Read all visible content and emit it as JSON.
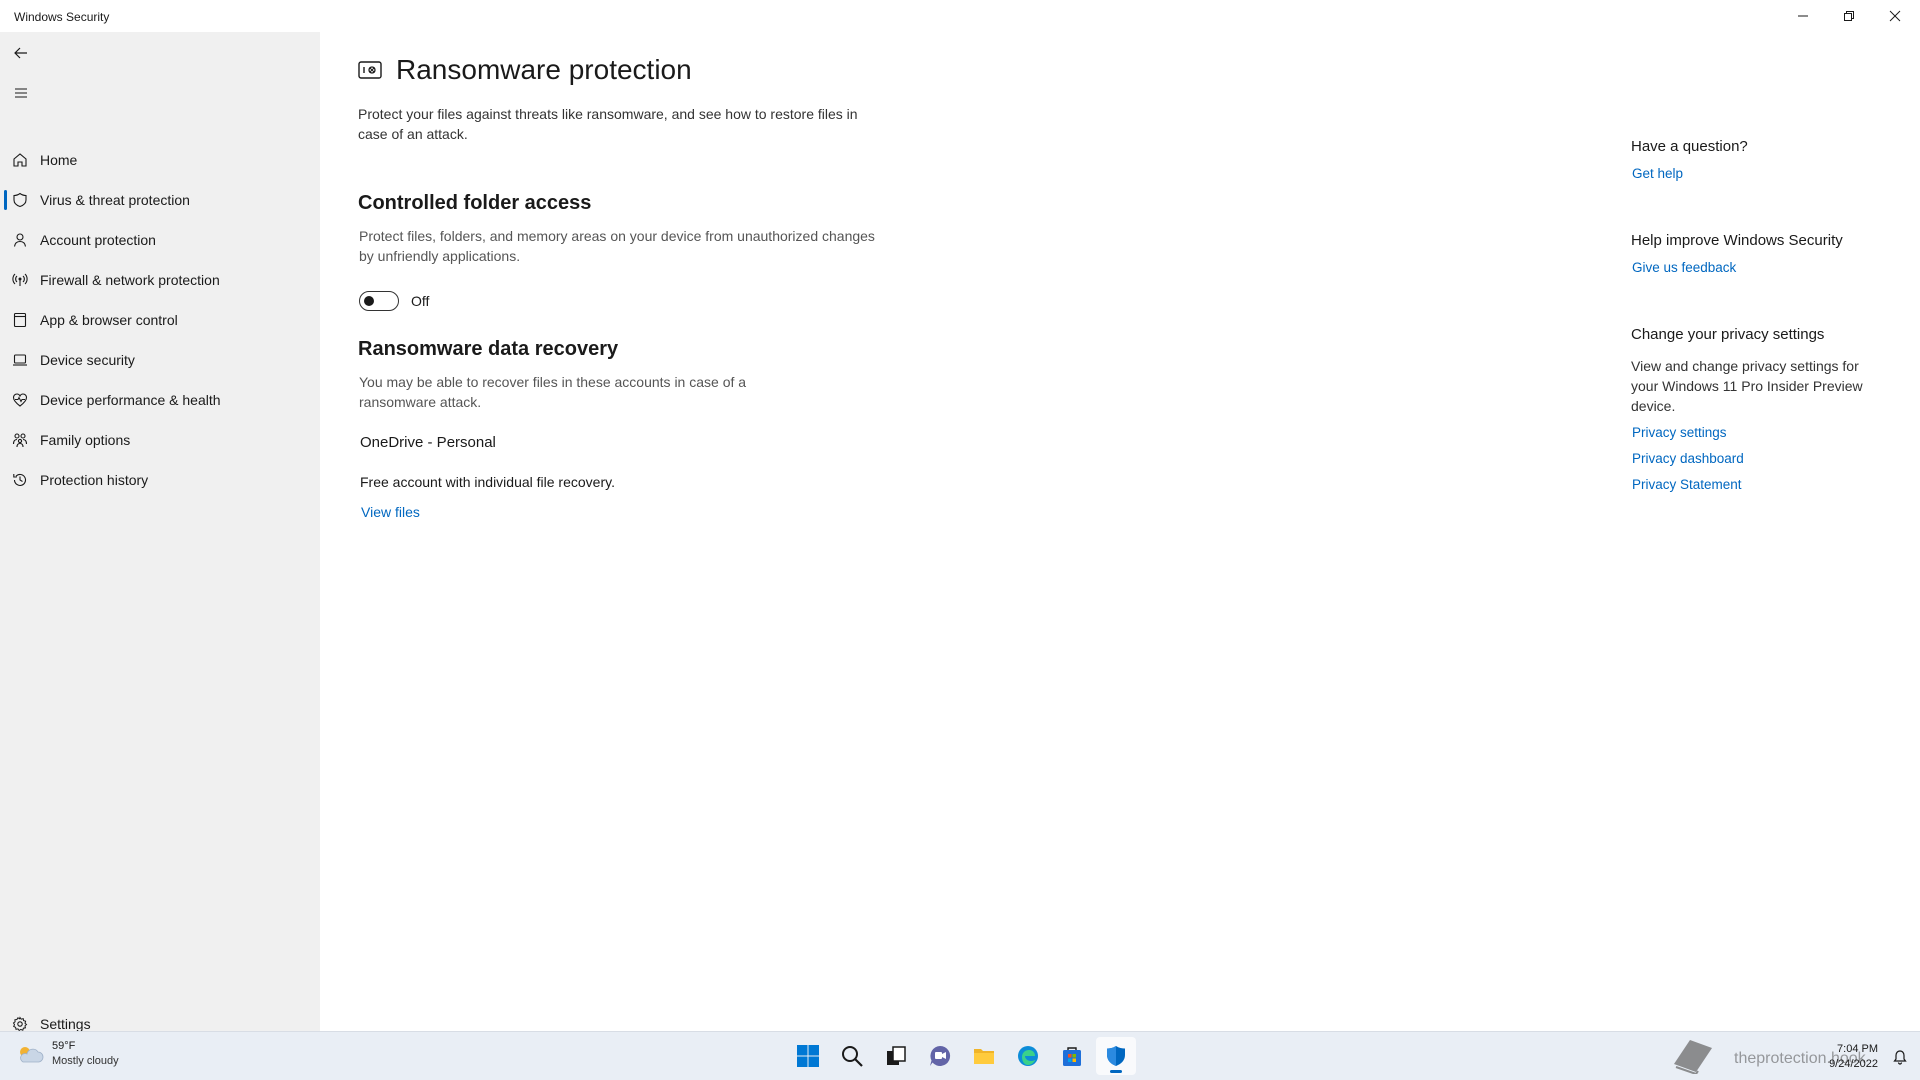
{
  "window": {
    "title": "Windows Security"
  },
  "sidebar": {
    "items": [
      {
        "label": "Home",
        "icon": "home-icon"
      },
      {
        "label": "Virus & threat protection",
        "icon": "shield-icon",
        "active": true
      },
      {
        "label": "Account protection",
        "icon": "person-icon"
      },
      {
        "label": "Firewall & network protection",
        "icon": "antenna-icon"
      },
      {
        "label": "App & browser control",
        "icon": "app-window-icon"
      },
      {
        "label": "Device security",
        "icon": "laptop-icon"
      },
      {
        "label": "Device performance & health",
        "icon": "heart-pulse-icon"
      },
      {
        "label": "Family options",
        "icon": "family-icon"
      },
      {
        "label": "Protection history",
        "icon": "history-icon"
      }
    ],
    "settings_label": "Settings"
  },
  "main": {
    "title": "Ransomware protection",
    "description": "Protect your files against threats like ransomware, and see how to restore files in case of an attack.",
    "controlled_folder": {
      "title": "Controlled folder access",
      "description": "Protect files, folders, and memory areas on your device from unauthorized changes by unfriendly applications.",
      "toggle_label": "Off"
    },
    "recovery": {
      "title": "Ransomware data recovery",
      "description": "You may be able to recover files in these accounts in case of a ransomware attack.",
      "account_name": "OneDrive - Personal",
      "account_desc": "Free account with individual file recovery.",
      "view_files": "View files"
    }
  },
  "side_panel": {
    "question_title": "Have a question?",
    "get_help": "Get help",
    "improve_title": "Help improve Windows Security",
    "feedback": "Give us feedback",
    "privacy_title": "Change your privacy settings",
    "privacy_desc": "View and change privacy settings for your Windows 11 Pro Insider Preview device.",
    "privacy_settings": "Privacy settings",
    "privacy_dashboard": "Privacy dashboard",
    "privacy_statement": "Privacy Statement"
  },
  "taskbar": {
    "weather_temp": "59°F",
    "weather_cond": "Mostly cloudy",
    "time": "7:04 PM",
    "date": "9/24/2022",
    "watermark": "theprotection.hook"
  },
  "colors": {
    "accent": "#0067c0",
    "sidebar_bg": "#f0f0f0",
    "taskbar_bg": "#e9eef5"
  }
}
